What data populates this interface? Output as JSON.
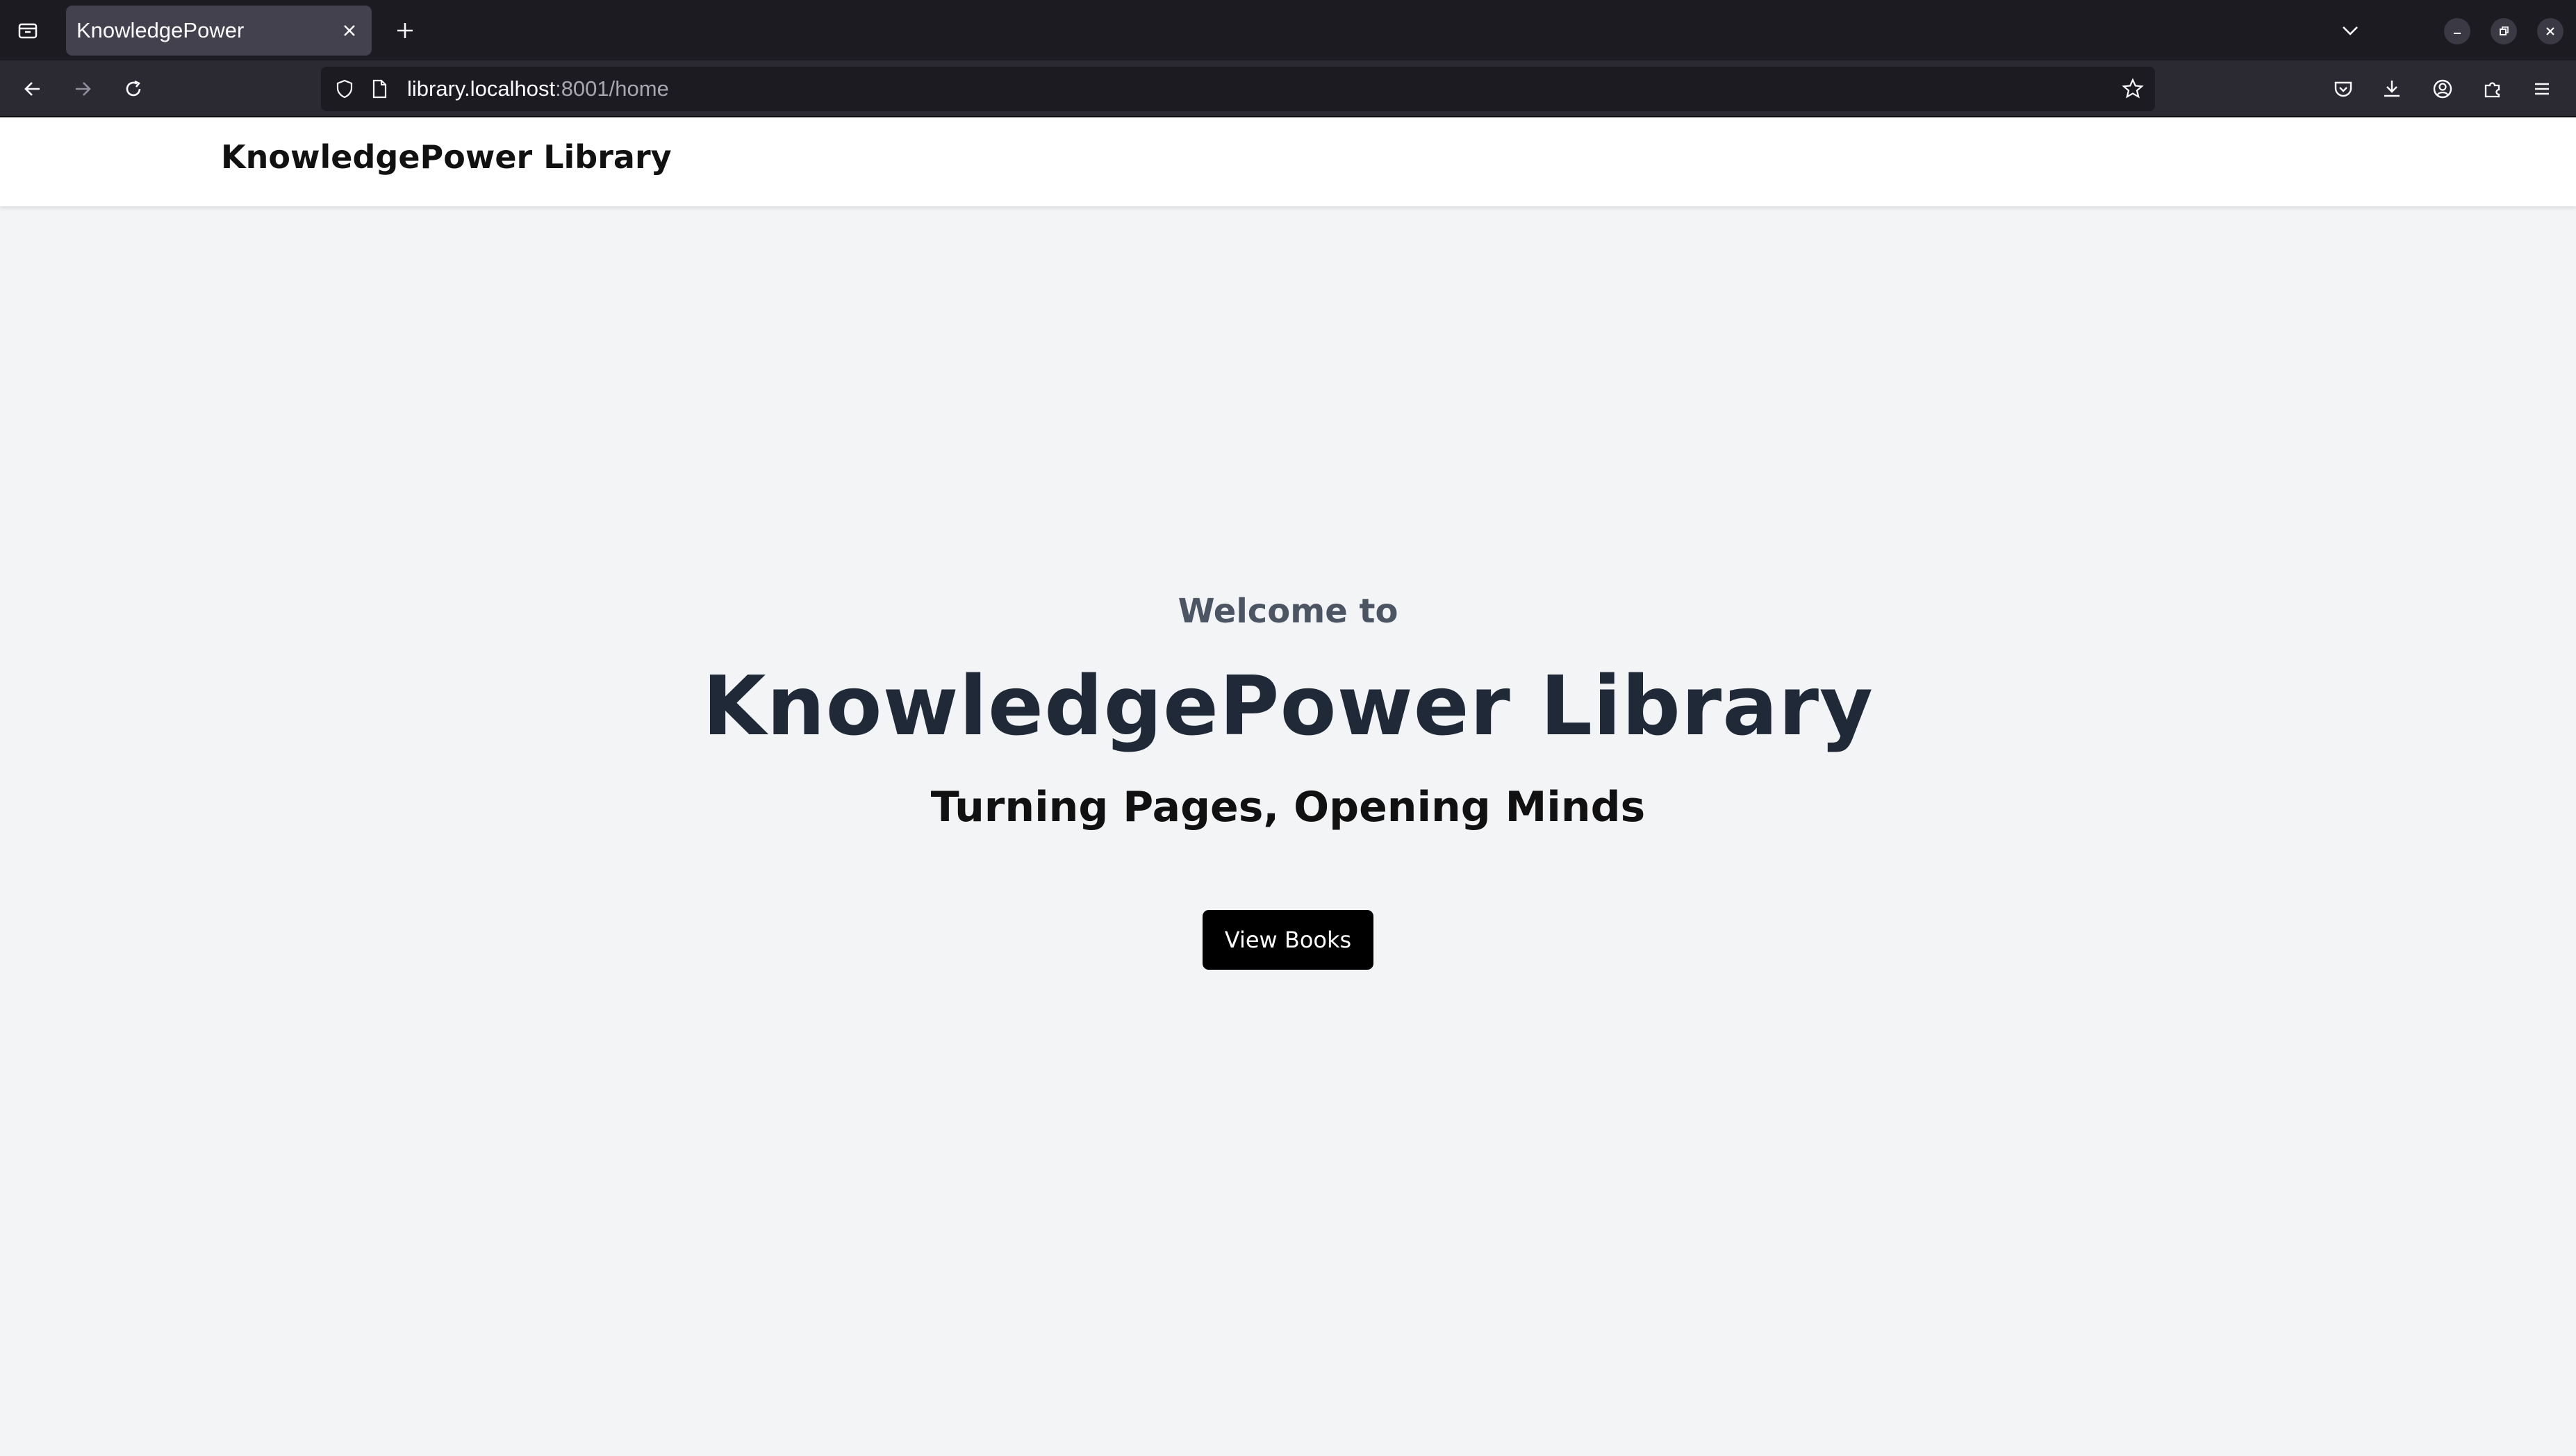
{
  "browser": {
    "tab_title": "KnowledgePower",
    "url_host": "library.localhost",
    "url_path": ":8001/home"
  },
  "header": {
    "site_title": "KnowledgePower Library"
  },
  "hero": {
    "welcome": "Welcome to",
    "title": "KnowledgePower Library",
    "tagline": "Turning Pages, Opening Minds",
    "cta_label": "View Books"
  },
  "icons": {
    "tab_list": "tab-list-icon",
    "close_tab": "close-icon",
    "new_tab": "plus-icon",
    "list_all_tabs": "chevron-down-icon",
    "minimize": "minimize-icon",
    "restore": "restore-icon",
    "close_window": "close-icon",
    "back": "arrow-left-icon",
    "forward": "arrow-right-icon",
    "reload": "reload-icon",
    "shield": "shield-icon",
    "page": "page-icon",
    "bookmark": "star-icon",
    "pocket": "pocket-icon",
    "downloads": "download-icon",
    "account": "account-icon",
    "extensions": "puzzle-icon",
    "menu": "hamburger-icon"
  },
  "colors": {
    "page_background": "#f3f4f6",
    "header_background": "#ffffff",
    "button_background": "#000000",
    "browser_chrome": "#1c1b22"
  }
}
